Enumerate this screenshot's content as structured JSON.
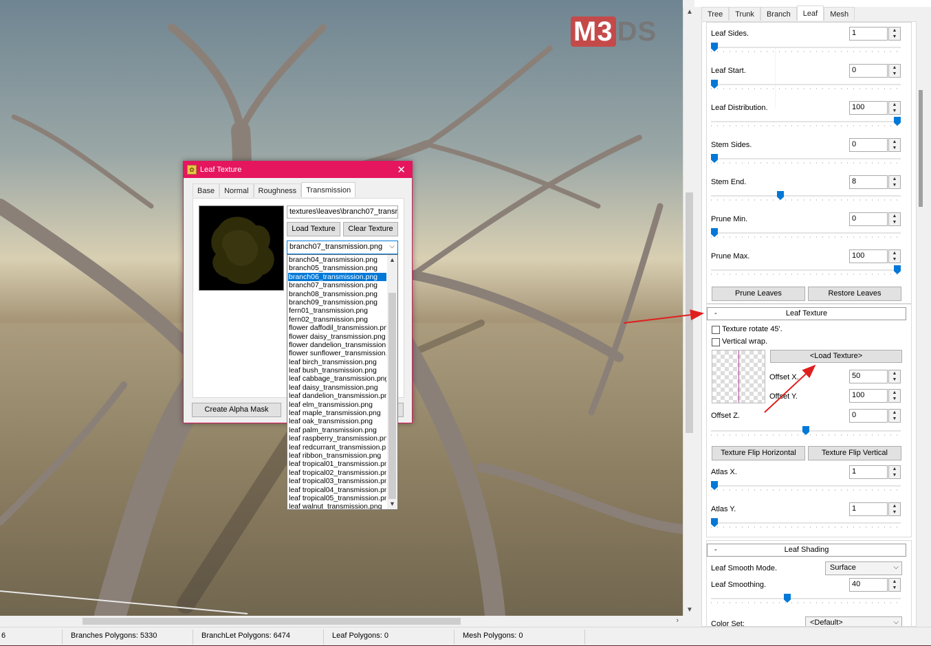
{
  "viewport": {
    "logo_primary": "M3",
    "logo_secondary": "DS"
  },
  "dialog": {
    "title": "Leaf Texture",
    "tabs": [
      "Base",
      "Normal",
      "Roughness",
      "Transmission"
    ],
    "active_tab": "Transmission",
    "path_value": "textures\\leaves\\branch07_transmis",
    "load_texture_label": "Load Texture",
    "clear_texture_label": "Clear Texture",
    "combo_value": "branch07_transmission.png",
    "create_alpha_mask_label": "Create Alpha Mask",
    "dropdown_items": [
      "branch04_transmission.png",
      "branch05_transmission.png",
      "branch06_transmission.png",
      "branch07_transmission.png",
      "branch08_transmission.png",
      "branch09_transmission.png",
      "fern01_transmission.png",
      "fern02_transmission.png",
      "flower daffodil_transmission.png",
      "flower daisy_transmission.png",
      "flower dandelion_transmission.p",
      "flower sunflower_transmission.pi",
      "leaf birch_transmission.png",
      "leaf bush_transmission.png",
      "leaf cabbage_transmission.png",
      "leaf daisy_transmission.png",
      "leaf dandelion_transmission.png",
      "leaf elm_transmission.png",
      "leaf maple_transmission.png",
      "leaf oak_transmission.png",
      "leaf palm_transmission.png",
      "leaf raspberry_transmission.png",
      "leaf redcurrant_transmission.pnc",
      "leaf ribbon_transmission.png",
      "leaf tropical01_transmission.png",
      "leaf tropical02_transmission.png",
      "leaf tropical03_transmission.png",
      "leaf tropical04_transmission.png",
      "leaf tropical05_transmission.png",
      "leaf walnut_transmission.png"
    ],
    "selected_index": 2
  },
  "rpanel": {
    "tabs": [
      "Tree",
      "Trunk",
      "Branch",
      "Leaf",
      "Mesh"
    ],
    "active_tab": "Leaf",
    "leaf_sides": {
      "label": "Leaf Sides.",
      "value": "1",
      "pos": 0.0
    },
    "leaf_start": {
      "label": "Leaf Start.",
      "value": "0",
      "pos": 0.0
    },
    "leaf_distribution": {
      "label": "Leaf Distribution.",
      "value": "100",
      "pos": 1.0
    },
    "stem_sides": {
      "label": "Stem Sides.",
      "value": "0",
      "pos": 0.0
    },
    "stem_end": {
      "label": "Stem End.",
      "value": "8",
      "pos": 0.36
    },
    "prune_min": {
      "label": "Prune Min.",
      "value": "0",
      "pos": 0.0
    },
    "prune_max": {
      "label": "Prune Max.",
      "value": "100",
      "pos": 1.0
    },
    "prune_leaves_label": "Prune Leaves",
    "restore_leaves_label": "Restore Leaves",
    "leaf_texture_header": "Leaf Texture",
    "leaf_texture_minus": "-",
    "texture_rotate_label": "Texture rotate 45'.",
    "vertical_wrap_label": "Vertical wrap.",
    "load_texture_label": "<Load Texture>",
    "offset_x": {
      "label": "Offset X.",
      "value": "50"
    },
    "offset_y": {
      "label": "Offset Y.",
      "value": "100"
    },
    "offset_z": {
      "label": "Offset Z.",
      "value": "0",
      "pos": 0.5
    },
    "flip_h_label": "Texture Flip Horizontal",
    "flip_v_label": "Texture Flip Vertical",
    "atlas_x": {
      "label": "Atlas X.",
      "value": "1",
      "pos": 0.0
    },
    "atlas_y": {
      "label": "Atlas Y.",
      "value": "1",
      "pos": 0.0
    },
    "leaf_shading_header": "Leaf Shading",
    "leaf_shading_minus": "-",
    "leaf_smooth_mode_label": "Leaf Smooth Mode.",
    "leaf_smooth_mode_value": "Surface",
    "leaf_smoothing": {
      "label": "Leaf Smoothing.",
      "value": "40",
      "pos": 0.4
    },
    "color_set_label": "Color Set:",
    "color_set_value": "<Default>"
  },
  "status": {
    "first": "6",
    "branches": "Branches Polygons: 5330",
    "branchlet": "BranchLet Polygons: 6474",
    "leaf": "Leaf Polygons:  0",
    "mesh": "Mesh Polygons:  0"
  },
  "colors": {
    "accent": "#0078d7",
    "dialog_title": "#e5155e",
    "annotation": "#e01e1e"
  }
}
